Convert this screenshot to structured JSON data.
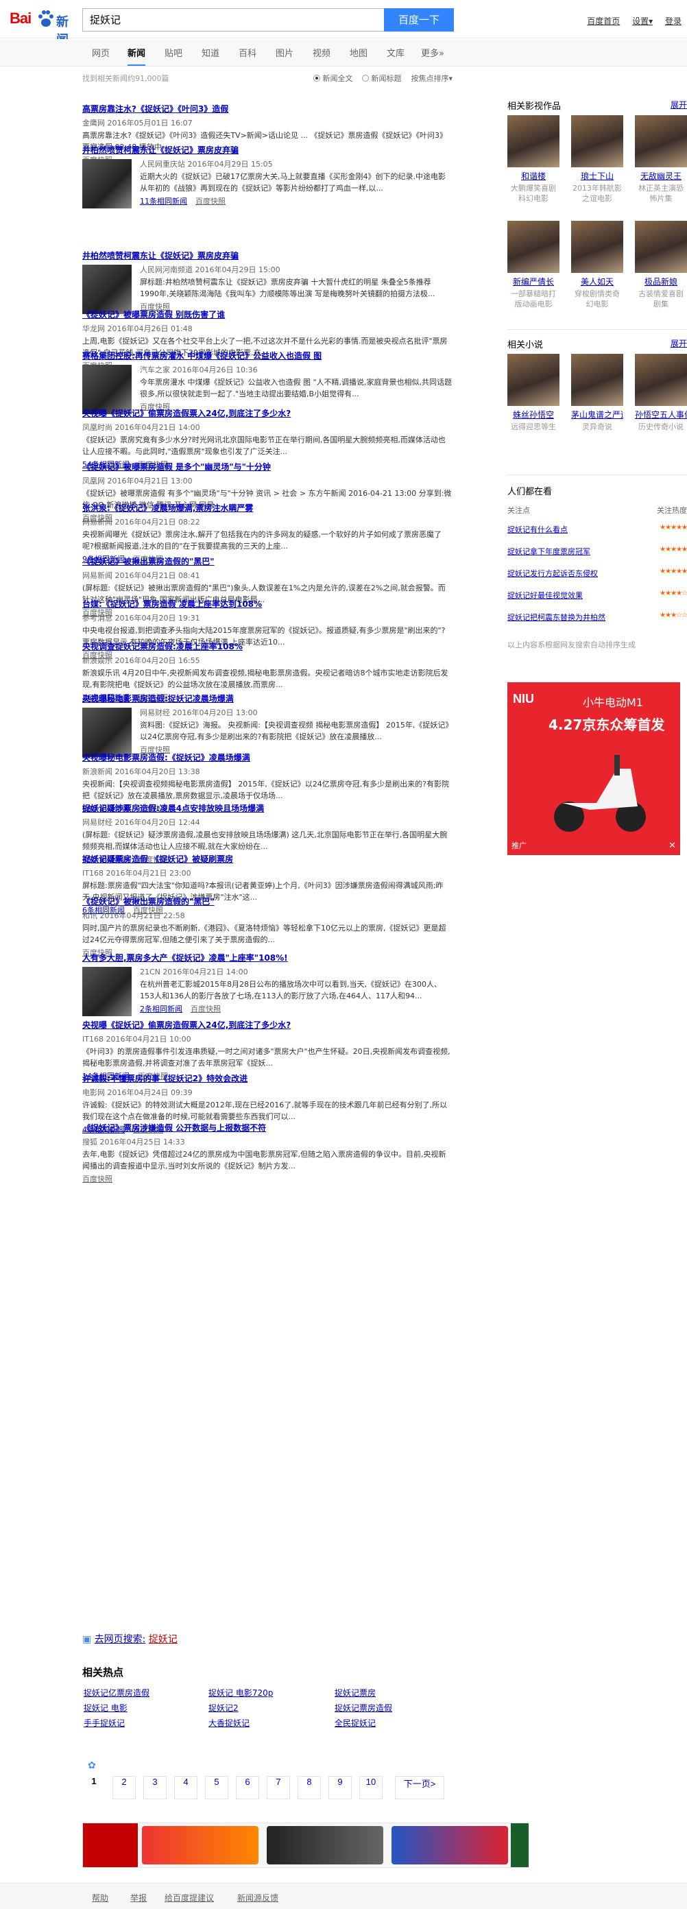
{
  "header": {
    "logo_text": "Bai",
    "logo_product": "新闻",
    "search_value": "捉妖记",
    "search_button": "百度一下",
    "links": [
      "百度首页",
      "设置▾",
      "登录"
    ]
  },
  "nav": {
    "tabs": [
      "网页",
      "新闻",
      "贴吧",
      "知道",
      "百科",
      "图片",
      "视频",
      "地图",
      "文库",
      "更多»"
    ],
    "active": "新闻"
  },
  "result_bar": {
    "count_text": "找到相关新闻约91,000篇",
    "opt_full": "新闻全文",
    "opt_title": "新闻标题",
    "sort": "按焦点排序▾"
  },
  "results": [
    {
      "title": "高票房靠注水?《捉妖记》《叶问3》造假",
      "src": "金鹰网  2016年05月01日 16:07",
      "sum": "高票房靠注水?《捉妖记》《叶问3》造假还失TV>新闻>话山论见 ... 《捉妖记》票房造假《捉妖记》《叶问3》票房造假 02:48 播放中 ...",
      "rel": "",
      "snap": "百度快照"
    },
    {
      "title": "井柏然喷赞柯震东让《捉妖记》票房皮弃骗",
      "src": "人民网重庆站  2016年04月29日 15:05",
      "sum": "近期大火的《捉妖记》已破17亿票房大关,马上就要直播《买形金刚4》创下的纪录.中途电影从年初的《战狼》再到现在的《捉妖记》等影片纷纷都打了鸡血一样,以...",
      "rel": "11条相同新闻",
      "snap": "百度快照"
    },
    {
      "title": "井柏然喷赞柯震东让《捉妖记》票房皮弃骗",
      "src": "人民网河南频道  2016年04月29日 15:00",
      "sum": "屏标题:井柏然喷赞柯震东让《捉妖记》票房皮弃骗 十大暂什虎红的明星 朱叠全5条推荐 1990年,关晓颖陈渴海陆《我叫车》力顺模陈等出演 写是梅晚努叶关镜翻的拍摄方法极...",
      "rel": "",
      "snap": "百度快照"
    },
    {
      "title": "《捉妖记》被曝票房造假 别既伤害了谁",
      "src": "华龙网  2016年04月26日 01:48",
      "sum": "上周,电影《捉妖记》又在各个社交平台上火了一把,不过这次并不是什么光彩的事情.而是被央视点名批评\"票房造假\",自己花钱,买自己公司旗下29家影城的电影票.充...",
      "rel": "",
      "snap": "百度快照"
    },
    {
      "title": "赛格集团控股:再传票房灌水 中煤爆《捉妖记》公益收入也造假 图",
      "src": "汽车之家  2016年04月26日 10:36",
      "sum": "今年票房灌水 中煤爆《捉妖记》公益收入也造假 图 \"人不精,调播说,家庭背景也相似,共同话题很多,所以很快就走到一起了.\"当地主动提出要结婚,B小姐觉得有...",
      "rel": "",
      "snap": "百度快照"
    },
    {
      "title": "央视曝《捉妖记》偷票房造假票入24亿,到底注了多少水?",
      "src": "凤凰时尚  2016年04月21日 14:00",
      "sum": "《捉妖记》票房究竟有多少水分?时光网讯北京国际电影节正在举行期间,各国明星大腕频频亮相,而媒体活动也让人应接不暇。与此同时,\"造假票房\"现象也引发了广泛关注...",
      "rel": "54条相同新闻",
      "snap": "百度快照"
    },
    {
      "title": "《捉妖记》被曝票房造假 是多个\"幽灵场\"与\"十分钟",
      "src": "凤凰网  2016年04月21日 13:00",
      "sum": "《捉妖记》被曝票房造假 有多个\"幽灵场\"与\"十分钟 资讯 > 社会 > 东方午新闻 2016-04-21 13:00 分享到:微信 QQ 新浪微博 微信 腾讯 开心网 网易...",
      "rel": "",
      "snap": "百度快照"
    },
    {
      "title": "张洪泉:《捉妖记》凌晨场爆满,票房注水瞒严雾",
      "src": "网易新闻  2016年04月21日 08:22",
      "sum": "央视新闻曝光《捉妖记》票房注水,解开了包括我在内的许多网友的疑惑,一个软好的片子如何成了票房恶魔了呢?根据新闻报道,注水的目的\"在于我要提高我的三天的上座...",
      "rel": "9条相同新闻",
      "snap": "百度快照"
    },
    {
      "title": "《捉妖记》被揪出票房造假的\"黑巴\"",
      "src": "网易新闻  2016年04月21日 08:41",
      "sum": "(屏标题:《捉妖记》被揪出票房造假的\"黑巴\")象头,人数误差在1%之内是允许的,误差在2%之间,就会报警。而针对这种\"幽灵场\"现象,国家新闻出版广电总局电影局...",
      "rel": "",
      "snap": "百度快照"
    },
    {
      "title": "台媒:《捉妖记》票房造假 凌晨上座率达到108%",
      "src": "参考消息  2016年04月20日 19:31",
      "sum": "中央电视台报道,到把调查矛头指向大陆2015年度票房冠军的《捉妖记》。报道质疑,有多少票房是\"刷出来的\"?票房数据显示,有较晚的午夜场于仅场场爆满,上座率达近10...",
      "rel": "",
      "snap": "百度快照"
    },
    {
      "title": "央视调查捉妖记票房造假:凌晨上座率108%",
      "src": "新浪娱乐  2016年04月20日 16:55",
      "sum": "新浪娱乐讯 4月20日中午,央视新闻发布调查视频,揭秘电影票房造假。央视记者暗访8个城市实地走访影院后发现,有影院把电《捉妖记》的公益场次放在凌晨播放,而票房...",
      "rel": "26条相同新闻",
      "snap": "百度快照"
    },
    {
      "title": "央视曝秘电影票房造假:捉妖记凌晨场爆满",
      "src": "网易财经  2016年04月20日 13:00",
      "sum": "资料图:《捉妖记》海报。 央视新闻:【央视调查视频 揭秘电影票房造假】 2015年,《捉妖记》以24亿票房夺冠,有多少是刷出来的?有影院把《捉妖记》放在凌晨播放...",
      "rel": "",
      "snap": "百度快照"
    },
    {
      "title": "央视曝秘电影票房造假:《捉妖记》凌晨场爆满",
      "src": "新浪新闻  2016年04月20日 13:38",
      "sum": "央视新闻:【央视调查视频揭秘电影票房造假】 2015年,《捉妖记》以24亿票房夺冠,有多少是刷出来的?有影院把《捉妖记》放在凌晨播放,票房数据显示,凌晨场于仅场场...",
      "rel": "98条相同新闻",
      "snap": "百度快照"
    },
    {
      "title": "捉妖记疑涉票房造假:凌晨4点安排放映且场场爆满",
      "src": "网易财经  2016年04月20日 12:44",
      "sum": "(屏标题:《捉妖记》疑涉票房造假,凌晨也安排放映且场场爆满) 这几天,北京国际电影节正在举行,各国明星大腕频频亮相,而媒体活动也让人应接不暇,就在大家纷纷在...",
      "rel": "45条相同新闻",
      "snap": "百度快照"
    },
    {
      "title": "捉妖记疑票房造假 《捉妖记》被疑刷票房",
      "src": "IT168  2016年04月21日 23:00",
      "sum": "屏标题:票房造假\"四大法宝\"你知道吗?本报讯(记者黄亚婷)上个月,《叶问3》因涉嫌票房造假闹得满城风雨;昨天,央视新闻又报道了《捉妖记》涉嫌票房\"注水\"这...",
      "rel": "6条相同新闻",
      "snap": "百度快照"
    },
    {
      "title": "《捉妖记》被揪出票房造假的\"黑巴\"",
      "src": "和讯  2016年04月21日 22:58",
      "sum": "同时,国产片的票房纪录也不断刷新,《港囧》、《夏洛特烦恼》等轻松拿下10亿元以上的票房,《捉妖记》更是超过24亿元夺得票房冠军,但随之便引来了关于票房造假的...",
      "rel": "",
      "snap": "百度快照"
    },
    {
      "title": "人有多大胆,票房多大产《捉妖记》凌晨\"上座率\"108%!",
      "src": "21CN  2016年04月21日 14:00",
      "sum": "在杭州普老汇影城2015年8月28日公布的播放场次中可以看到,当天,《捉妖记》在300人、153人和136人的影厅各放了七场,在113人的影厅放了六场,在464人、117人和94...",
      "rel": "2条相同新闻",
      "snap": "百度快照"
    },
    {
      "title": "央视曝《捉妖记》偷票房造假票入24亿,到底注了多少水?",
      "src": "IT168  2016年04月21日 10:00",
      "sum": "《叶问3》的票房造假事件引发连串质疑,一时之间对诸多\"票房大户\"也产生怀疑。20日,央视新闻发布调查视频,揭秘电影票房造假,并将调查对准了去年票房冠军《捉妖...",
      "rel": "14条相同新闻",
      "snap": "百度快照"
    },
    {
      "title": "许诚毅:不懂票房的事《捉妖记2》特效会改进",
      "src": "电影网  2016年04月24日 09:39",
      "sum": "许诚毅:《捉妖记》的特效测试大概是2012年,现在已经2016了,就等手现在的技术跟几年前已经有分别了,所以我们现在这个点在做准备的时候,可能就看需要些东西我们可以...",
      "rel": "4条相同新闻",
      "snap": "百度快照"
    },
    {
      "title": "《捉妖记》票房涉嫌造假 公开数据与上报数据不符",
      "src": "搜狐  2016年04月25日 14:33",
      "sum": "去年,电影《捉妖记》凭借超过24亿的票房成为中国电影票房冠军,但随之陷入票房造假的争议中。目前,央视新闻播出的调查报道中显示,当时刘女所说的《捉妖记》制片方发...",
      "rel": "",
      "snap": "百度快照"
    }
  ],
  "search_web": {
    "label": "去网页搜索:",
    "query": "捉妖记"
  },
  "hot": {
    "title": "相关热点",
    "items": [
      "捉妖记亿票房造假",
      "捉妖记 电影720p",
      "捉妖记票房",
      "捉妖记 电影",
      "捉妖记2",
      "捉妖记票房造假",
      "手手捉妖记",
      "大香捉妖记",
      "全民捉妖记"
    ]
  },
  "pager": {
    "pages": [
      "1",
      "2",
      "3",
      "4",
      "5",
      "6",
      "7",
      "8",
      "9",
      "10"
    ],
    "current": "1",
    "next": "下一页>"
  },
  "footer": [
    "帮助",
    "举报",
    "给百度提建议",
    "新闻源反馈"
  ],
  "side": {
    "movies_title": "相关影视作品",
    "movies_expand": "展开",
    "movies": [
      {
        "name": "和谐楼",
        "desc": "大鹏爆笑喜剧科幻电影"
      },
      {
        "name": "琅士下山",
        "desc": "2013年韩航影之谊电影"
      },
      {
        "name": "无敌幽灵王",
        "desc": "林正英主演恐怖片集"
      },
      {
        "name": "新编严倩长",
        "desc": "一部暴糙暗打版动画电影"
      },
      {
        "name": "美人如天",
        "desc": "穿梭剧情类奇幻电影"
      },
      {
        "name": "极品新娘",
        "desc": "古装情爱喜剧剧集"
      }
    ],
    "novels_title": "相关小说",
    "novels_expand": "展开",
    "novels": [
      {
        "name": "蛛丝孙悟空",
        "desc": "远得迎思等生"
      },
      {
        "name": "茅山鬼谱之严道",
        "desc": "灵异奇说"
      },
      {
        "name": "孙悟空五人事件",
        "desc": "历史传奇小说"
      }
    ],
    "hot_title": "人们都在看",
    "hot_head": [
      "关注点",
      "关注热度"
    ],
    "hot_rows": [
      {
        "kw": "捉妖记有什么看点",
        "stars": "★★★★★"
      },
      {
        "kw": "捉妖记拿下年度票房冠军",
        "stars": "★★★★★"
      },
      {
        "kw": "捉妖记发行方起诉否东侵权",
        "stars": "★★★★★"
      },
      {
        "kw": "捉妖记好最佳视觉效果",
        "stars": "★★★★☆"
      },
      {
        "kw": "捉妖记把柯震东替换为井柏然",
        "stars": "★★★☆☆"
      }
    ],
    "hot_note": "以上内容系根据网友搜索自动排序生成"
  },
  "ad": {
    "brand": "NIU",
    "model": "小牛电动M1",
    "headline": "4.27京东众筹首发",
    "tag": "推广",
    "close": "✕"
  }
}
